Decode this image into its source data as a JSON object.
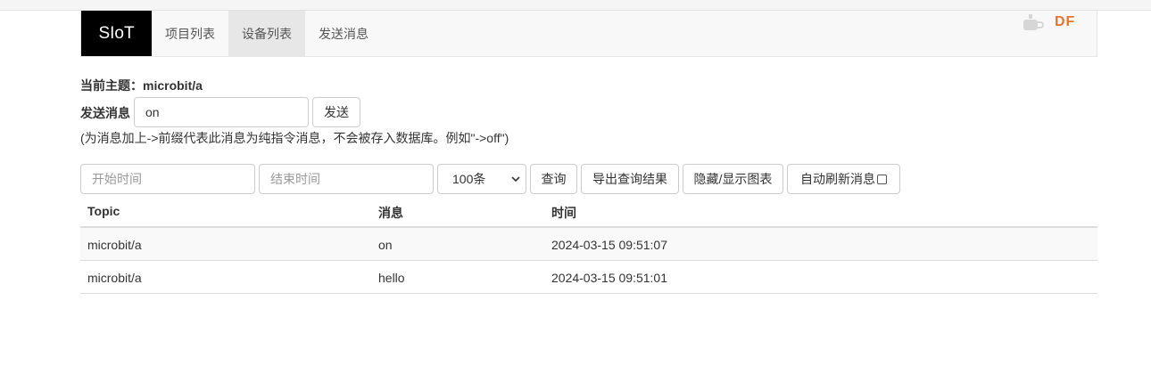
{
  "nav": {
    "brand": "SIoT",
    "items": [
      {
        "label": "项目列表",
        "active": false
      },
      {
        "label": "设备列表",
        "active": true
      },
      {
        "label": "发送消息",
        "active": false
      }
    ]
  },
  "watermark": {
    "text": "DF"
  },
  "topic": {
    "text": "当前主题：microbit/a"
  },
  "send": {
    "label": "发送消息",
    "value": "on",
    "button": "发送",
    "hint": "(为消息加上->前缀代表此消息为纯指令消息，不会被存入数据库。例如\"->off\")"
  },
  "query": {
    "start_placeholder": "开始时间",
    "end_placeholder": "结束时间",
    "limit_selected": "100条",
    "search_button": "查询",
    "export_button": "导出查询结果",
    "toggle_chart_button": "隐藏/显示图表",
    "auto_refresh_label": "自动刷新消息",
    "auto_refresh_checked": false
  },
  "table": {
    "headers": [
      "Topic",
      "消息",
      "时间"
    ],
    "rows": [
      [
        "microbit/a",
        "on",
        "2024-03-15 09:51:07"
      ],
      [
        "microbit/a",
        "hello",
        "2024-03-15 09:51:01"
      ]
    ]
  },
  "colors": {
    "brand_bg": "#000000",
    "active_tab": "#e7e7e7",
    "watermark": "#e8742c"
  }
}
